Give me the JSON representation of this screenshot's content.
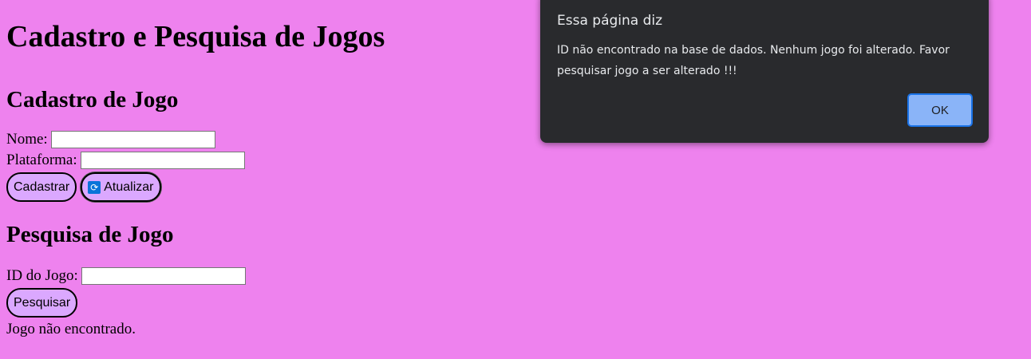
{
  "page": {
    "title": "Cadastro e Pesquisa de Jogos",
    "background": "#ee82ee"
  },
  "cadastro": {
    "heading": "Cadastro de Jogo",
    "nome_label": "Nome:",
    "nome_value": "",
    "plataforma_label": "Plataforma:",
    "plataforma_value": "",
    "cadastrar_button": "Cadastrar",
    "atualizar_button": "Atualizar",
    "atualizar_icon": "refresh-icon"
  },
  "pesquisa": {
    "heading": "Pesquisa de Jogo",
    "id_label": "ID do Jogo:",
    "id_value": "",
    "pesquisar_button": "Pesquisar",
    "result_text": "Jogo não encontrado."
  },
  "dialog": {
    "title": "Essa página diz",
    "message": "ID não encontrado na base de dados. Nenhum jogo foi alterado. Favor pesquisar jogo a ser alterado !!!",
    "ok_button": "OK",
    "background": "#292a2d",
    "button_color": "#8ab4f8"
  },
  "colors": {
    "button_fill": "#dba8ff",
    "accent": "#1a73e8"
  }
}
